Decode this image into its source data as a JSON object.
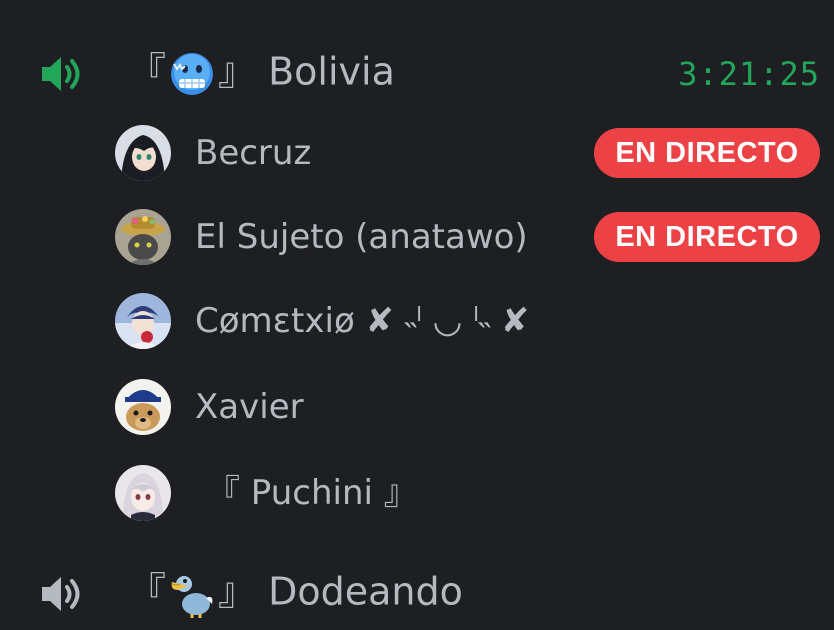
{
  "colors": {
    "background": "#1e1f22",
    "text": "#b5bac1",
    "active_speaker": "#23a55a",
    "inactive_speaker": "#b5bac1",
    "timer": "#23a55a",
    "live_badge": "#ed4245"
  },
  "channels": [
    {
      "name": "『🥶』 Bolivia",
      "name_prefix": "『",
      "name_emoji": "cold-face-emoji",
      "name_suffix": "』 Bolivia",
      "speaker_icon": "speaker-icon",
      "active": true,
      "timer": "3:21:25",
      "users": [
        {
          "name": "Becruz",
          "live": true,
          "live_label": "EN DIRECTO",
          "avatar": "anime-girl-avatar"
        },
        {
          "name": "El Sujeto (anatawo)",
          "live": true,
          "live_label": "EN DIRECTO",
          "avatar": "cat-hat-avatar"
        },
        {
          "name": "Cømɛtxiø ✘ ˵ˡ ◡ ˡ˵ ✘",
          "live": false,
          "avatar": "anime-boy-avatar"
        },
        {
          "name": "Xavier",
          "live": false,
          "avatar": "dog-cap-avatar"
        },
        {
          "name": "『 Puchini 』",
          "live": false,
          "avatar": "anime-girl-white-avatar"
        }
      ]
    },
    {
      "name": "『🦤』 Dodeando",
      "name_prefix": "『",
      "name_emoji": "dodo-emoji",
      "name_suffix": "』 Dodeando",
      "speaker_icon": "speaker-icon",
      "active": false
    }
  ]
}
